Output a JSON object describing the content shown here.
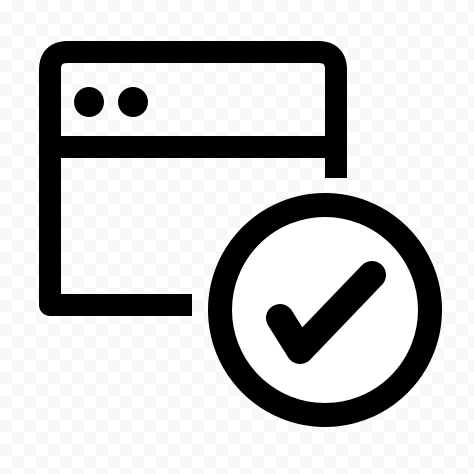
{
  "icon": {
    "name": "browser-window-check-icon",
    "stroke_color": "#000000",
    "background_color": "#ffffff"
  }
}
